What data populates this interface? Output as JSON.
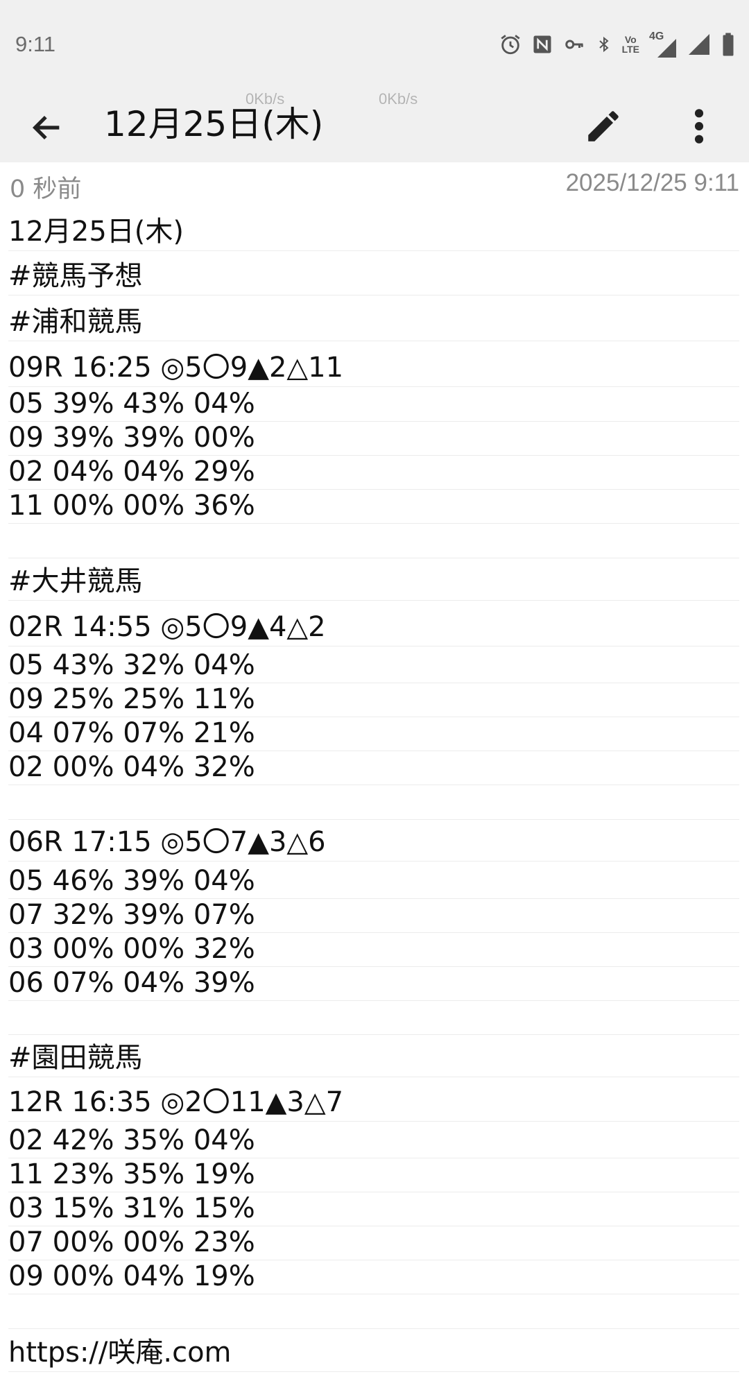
{
  "status_bar": {
    "time": "9:11",
    "icons": [
      "alarm-icon",
      "nfc-icon",
      "vpn-key-icon",
      "bluetooth-icon",
      "volte-icon",
      "4g-signal-icon",
      "signal-icon",
      "battery-icon"
    ],
    "volte_label_top": "Vo",
    "volte_label_bottom": "LTE",
    "network_label": "4G"
  },
  "app_bar": {
    "title": "12月25日(木)",
    "speed_1": "0Kb/s",
    "speed_2": "0Kb/s"
  },
  "meta": {
    "relative_time": "0 秒前",
    "timestamp": "2025/12/25 9:11"
  },
  "note": {
    "lines": [
      "12月25日(木)",
      "#競馬予想",
      "#浦和競馬",
      "09R 16:25 ◎5〇9▲2△11",
      "05 39% 43% 04%",
      "09 39% 39% 00%",
      "02 04% 04% 29%",
      "11 00% 00% 36%",
      "",
      "#大井競馬",
      "02R 14:55 ◎5〇9▲4△2",
      "05 43% 32% 04%",
      "09 25% 25% 11%",
      "04 07% 07% 21%",
      "02 00% 04% 32%",
      "",
      "06R 17:15 ◎5〇7▲3△6",
      "05 46% 39% 04%",
      "07 32% 39% 07%",
      "03 00% 00% 32%",
      "06 07% 04% 39%",
      "",
      "#園田競馬",
      "12R 16:35 ◎2〇11▲3△7",
      "02 42% 35% 04%",
      "11 23% 35% 19%",
      "03 15% 31% 15%",
      "07 00% 00% 23%",
      "09 00% 04% 19%",
      "",
      "https://咲庵.com"
    ]
  }
}
